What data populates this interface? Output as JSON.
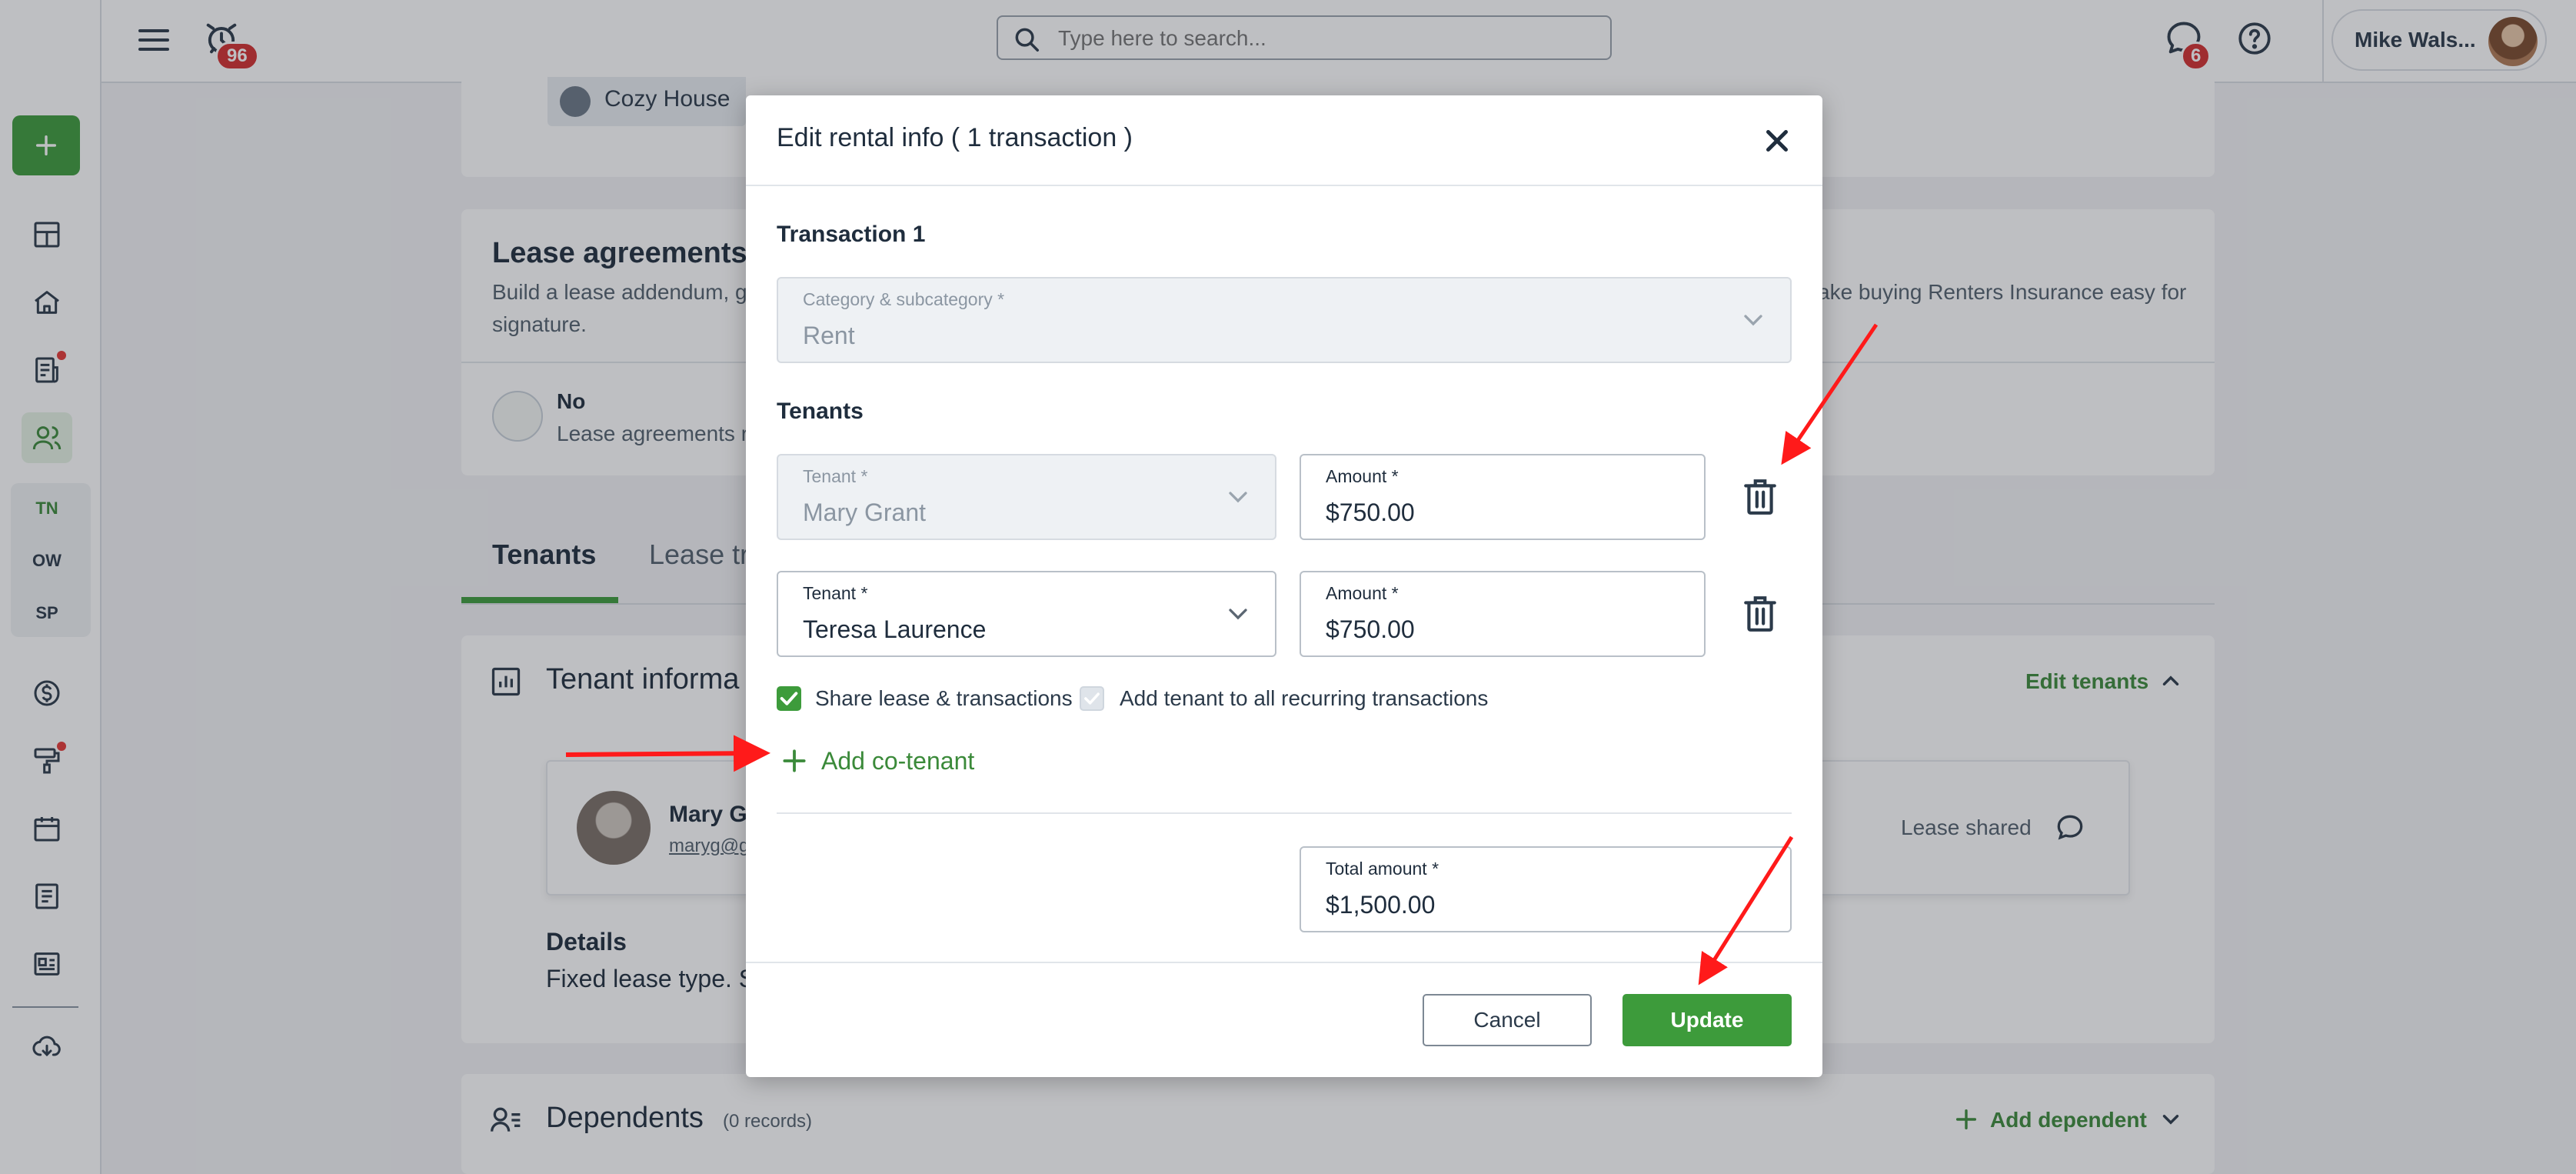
{
  "topbar": {
    "notifications_count": "96",
    "search_placeholder": "Type here to search...",
    "messages_count": "6",
    "user_name": "Mike Wals..."
  },
  "sidebar": {
    "sub_items": [
      "TN",
      "OW",
      "SP"
    ]
  },
  "page": {
    "property_chip": "Cozy House",
    "lease_title": "Lease agreements",
    "lease_desc_left": "Build a lease addendum, g",
    "lease_desc_left2": "signature.",
    "lease_desc_right": "ake buying Renters Insurance easy for",
    "lease_status": "No",
    "lease_status_desc": "Lease agreements r",
    "tabs": [
      "Tenants",
      "Lease tr"
    ],
    "tenant_info_title": "Tenant informa",
    "edit_tenants": "Edit tenants",
    "tenant_card_name": "Mary G",
    "tenant_card_email": "maryg@g",
    "lease_shared": "Lease shared",
    "details_title": "Details",
    "details_text": "Fixed lease type. S",
    "dependents_title": "Dependents",
    "dependents_count": "(0 records)",
    "add_dependent": "Add dependent"
  },
  "modal": {
    "title": "Edit rental info ( 1 transaction )",
    "transaction_title": "Transaction 1",
    "category": {
      "label": "Category & subcategory *",
      "value": "Rent"
    },
    "tenants_title": "Tenants",
    "tenant_rows": [
      {
        "tenant_label": "Tenant *",
        "tenant_value": "Mary Grant",
        "amount_label": "Amount *",
        "amount_value": "$750.00",
        "tenant_disabled": true
      },
      {
        "tenant_label": "Tenant *",
        "tenant_value": "Teresa Laurence",
        "amount_label": "Amount *",
        "amount_value": "$750.00",
        "tenant_disabled": false
      }
    ],
    "share_lease_label": "Share lease & transactions",
    "share_lease_checked": true,
    "add_recurring_label": "Add tenant to all recurring transactions",
    "add_recurring_checked": true,
    "add_cotenant_label": "Add co-tenant",
    "total": {
      "label": "Total amount *",
      "value": "$1,500.00"
    },
    "cancel_label": "Cancel",
    "update_label": "Update"
  },
  "colors": {
    "accent": "#3d9b3b",
    "badge": "#d32f2f",
    "annotation_arrow": "#ff1a1a"
  }
}
